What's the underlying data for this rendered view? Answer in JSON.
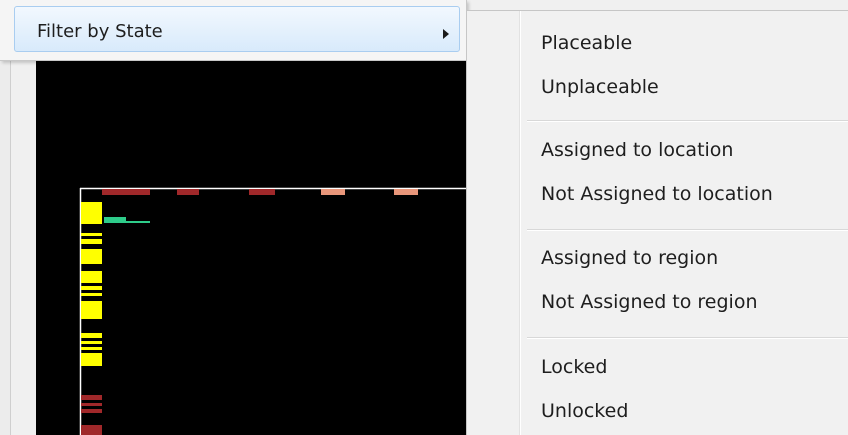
{
  "parent_menu": {
    "items": [
      {
        "label": "Filter by State",
        "has_submenu": true,
        "highlighted": true
      }
    ]
  },
  "submenu": {
    "groups": [
      [
        "Placeable",
        "Unplaceable"
      ],
      [
        "Assigned to location",
        "Not Assigned to location"
      ],
      [
        "Assigned to region",
        "Not Assigned to region"
      ],
      [
        "Locked",
        "Unlocked"
      ]
    ]
  },
  "colors": {
    "canvas_background": "#000000",
    "axis_line": "#ffffff",
    "dark_red_block": "#a0282a",
    "salmon_block": "#e8967a",
    "yellow_block": "#ffff00",
    "green_block": "#2ecc8a",
    "menu_highlight": "#d8eafb"
  }
}
